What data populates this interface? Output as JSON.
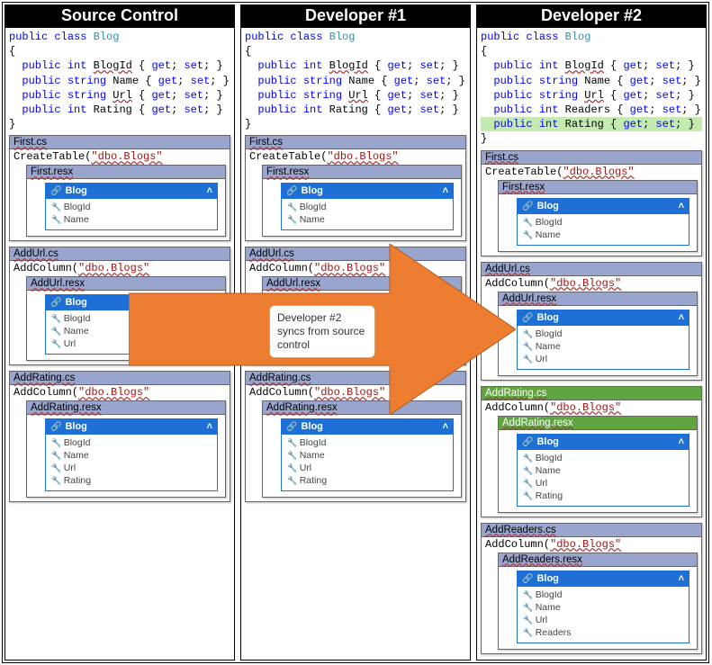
{
  "columns": [
    {
      "title": "Source Control",
      "highlightReaders": false,
      "greenAddRating": false,
      "hasReaders": false,
      "hasAddReadersFile": false
    },
    {
      "title": "Developer #1",
      "highlightReaders": false,
      "greenAddRating": false,
      "hasReaders": false,
      "hasAddReadersFile": false
    },
    {
      "title": "Developer #2",
      "highlightReaders": true,
      "greenAddRating": true,
      "hasReaders": true,
      "hasAddReadersFile": true
    }
  ],
  "code": {
    "classDecl1": "public",
    "classDecl2": "class",
    "className": "Blog",
    "brace_open": "{",
    "brace_close": "}",
    "lines": [
      {
        "prop": "BlogId",
        "type": "int"
      },
      {
        "prop": "Name",
        "type": "string"
      },
      {
        "prop": "Url",
        "type": "string"
      },
      {
        "prop": "Readers",
        "type": "int",
        "onlyCol": 2,
        "highlight": false
      },
      {
        "prop": "Rating",
        "type": "int"
      }
    ],
    "kw_public": "public",
    "kw_get": "get",
    "kw_set": "set",
    "getset_prefix": " { ",
    "getset_mid": "; ",
    "getset_suffix": "; }"
  },
  "files": {
    "first_cs": "First.cs",
    "first_resx": "First.resx",
    "first_code": "CreateTable(",
    "first_arg": "\"dbo.Blogs\"",
    "addurl_cs": "AddUrl.cs",
    "addurl_resx": "AddUrl.resx",
    "addrating_cs": "AddRating.cs",
    "addrating_resx": "AddRating.resx",
    "addreaders_cs": "AddReaders.cs",
    "addreaders_resx": "AddReaders.resx",
    "addcol_code": "AddColumn(",
    "addcol_arg": "\"dbo.Blogs\"",
    "quote_cont": "\""
  },
  "designer": {
    "header": "Blog",
    "rows_first": [
      "BlogId",
      "Name"
    ],
    "rows_url": [
      "BlogId",
      "Name",
      "Url"
    ],
    "rows_rating": [
      "BlogId",
      "Name",
      "Url",
      "Rating"
    ],
    "rows_readers": [
      "BlogId",
      "Name",
      "Url",
      "Readers"
    ]
  },
  "callout": "Developer #2 syncs from source control"
}
